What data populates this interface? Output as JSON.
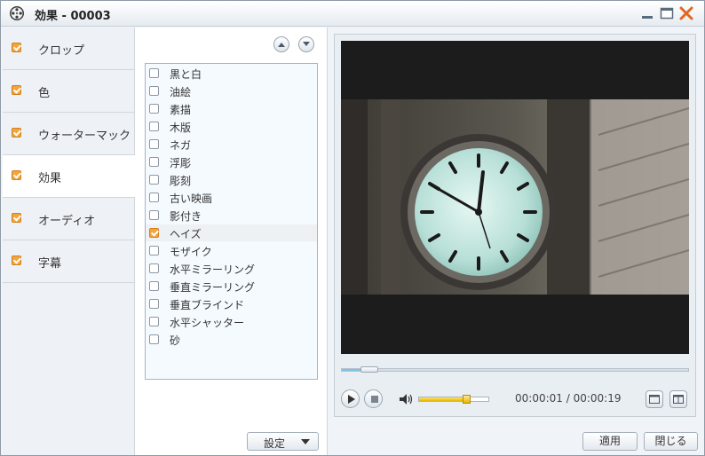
{
  "window": {
    "title": "効果 - 00003"
  },
  "sidebar": {
    "items": [
      {
        "label": "クロップ",
        "checked": true,
        "active": false
      },
      {
        "label": "色",
        "checked": true,
        "active": false
      },
      {
        "label": "ウォーターマック",
        "checked": true,
        "active": false
      },
      {
        "label": "効果",
        "checked": true,
        "active": true
      },
      {
        "label": "オーディオ",
        "checked": true,
        "active": false
      },
      {
        "label": "字幕",
        "checked": true,
        "active": false
      }
    ]
  },
  "effects": {
    "items": [
      {
        "label": "黒と白",
        "checked": false
      },
      {
        "label": "油絵",
        "checked": false
      },
      {
        "label": "素描",
        "checked": false
      },
      {
        "label": "木版",
        "checked": false
      },
      {
        "label": "ネガ",
        "checked": false
      },
      {
        "label": "浮彫",
        "checked": false
      },
      {
        "label": "彫刻",
        "checked": false
      },
      {
        "label": "古い映画",
        "checked": false
      },
      {
        "label": "影付き",
        "checked": false
      },
      {
        "label": "ヘイズ",
        "checked": true
      },
      {
        "label": "モザイク",
        "checked": false
      },
      {
        "label": "水平ミラーリング",
        "checked": false
      },
      {
        "label": "垂直ミラーリング",
        "checked": false
      },
      {
        "label": "垂直ブラインド",
        "checked": false
      },
      {
        "label": "水平シャッター",
        "checked": false
      },
      {
        "label": "砂",
        "checked": false
      }
    ],
    "settings_label": "設定"
  },
  "player": {
    "current_time": "00:00:01",
    "total_time": "00:00:19",
    "time_display": "00:00:01 / 00:00:19",
    "progress_fraction": 0.053,
    "volume_fraction": 0.68
  },
  "footer": {
    "apply_label": "適用",
    "close_label": "閉じる"
  },
  "colors": {
    "check_accent": "#f5a43c",
    "volume_fill": "#f0c400",
    "seek_fill": "#7ec3e8",
    "close_icon": "#e06820"
  }
}
